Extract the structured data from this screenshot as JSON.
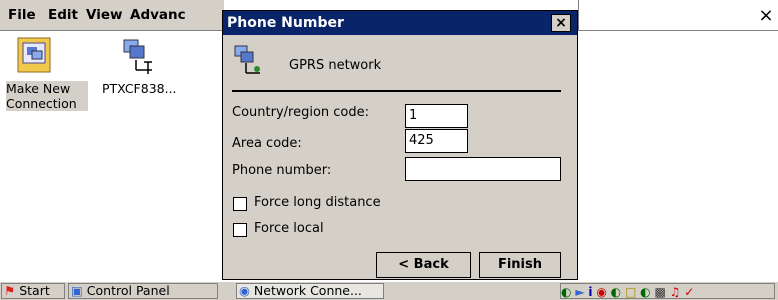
{
  "background_window": {
    "menu": [
      "File",
      "Edit",
      "View",
      "Advanc"
    ],
    "close_label": "×",
    "items": [
      {
        "label_line1": "Make New",
        "label_line2": "Connection"
      },
      {
        "label_line1": "PTXCF838...",
        "label_line2": ""
      }
    ]
  },
  "dialog": {
    "title": "Phone Number",
    "close_label": "×",
    "connection_name": "GPRS network",
    "country_label": "Country/region code:",
    "country_value": "1",
    "area_label": "Area code:",
    "area_value": "425",
    "phone_label": "Phone number:",
    "phone_value": "",
    "force_long_distance_label": "Force long distance",
    "force_local_label": "Force local",
    "back_button": "< Back",
    "finish_button": "Finish"
  },
  "taskbar": {
    "start": "Start",
    "tasks": [
      "Control Panel",
      "Network Conne..."
    ]
  },
  "colors": {
    "titlebar": "#0a246a",
    "face": "#d4d0c8"
  }
}
